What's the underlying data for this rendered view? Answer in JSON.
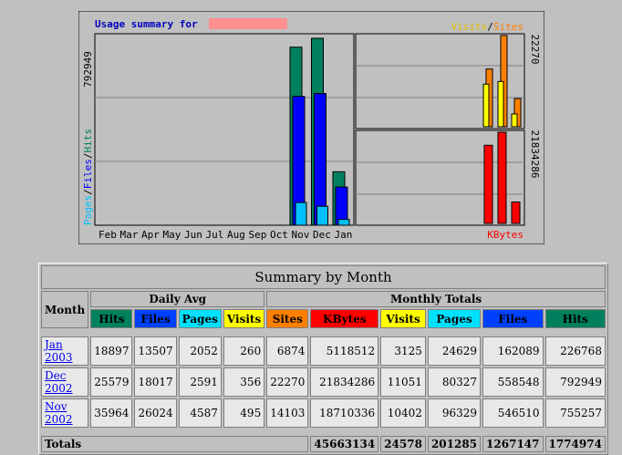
{
  "chart": {
    "title_prefix": "Usage summary for",
    "title_site": "",
    "legend_right_visits": "Visits",
    "legend_right_sep": "/",
    "legend_right_sites": "Sites",
    "kbytes_label": "KBytes",
    "left_axis_labels": {
      "pages": "Pages",
      "sep1": "/",
      "files": "Files",
      "sep2": "/",
      "hits": "Hits"
    },
    "left_max_label": "792949",
    "right_top_max_label": "22270",
    "right_bottom_max_label": "21834286",
    "months": [
      "Feb",
      "Mar",
      "Apr",
      "May",
      "Jun",
      "Jul",
      "Aug",
      "Sep",
      "Oct",
      "Nov",
      "Dec",
      "Jan"
    ],
    "colors": {
      "hits": "#00805c",
      "files": "#0000ff",
      "pages": "#00c0ff",
      "visits": "#ffff00",
      "sites": "#ff8000",
      "kbytes": "#ff0000",
      "bg": "#c0c0c0"
    }
  },
  "chart_data": {
    "type": "bar",
    "categories": [
      "Feb",
      "Mar",
      "Apr",
      "May",
      "Jun",
      "Jul",
      "Aug",
      "Sep",
      "Oct",
      "Nov",
      "Dec",
      "Jan"
    ],
    "series": [
      {
        "name": "Hits",
        "values": [
          0,
          0,
          0,
          0,
          0,
          0,
          0,
          0,
          0,
          755257,
          792949,
          226768
        ]
      },
      {
        "name": "Files",
        "values": [
          0,
          0,
          0,
          0,
          0,
          0,
          0,
          0,
          0,
          546510,
          558548,
          162089
        ]
      },
      {
        "name": "Pages",
        "values": [
          0,
          0,
          0,
          0,
          0,
          0,
          0,
          0,
          0,
          96329,
          80327,
          24629
        ]
      },
      {
        "name": "Visits",
        "values": [
          10402,
          11051,
          3125
        ]
      },
      {
        "name": "Sites",
        "values": [
          14103,
          22270,
          6874
        ]
      },
      {
        "name": "KBytes",
        "values": [
          18710336,
          21834286,
          5118512
        ]
      }
    ],
    "ylim_left": [
      0,
      792949
    ],
    "ylim_right_top": [
      0,
      22270
    ],
    "ylim_right_bottom": [
      0,
      21834286
    ]
  },
  "table": {
    "caption": "Summary by Month",
    "month_header": "Month",
    "daily_avg_header": "Daily Avg",
    "monthly_totals_header": "Monthly Totals",
    "cols_daily": [
      "Hits",
      "Files",
      "Pages",
      "Visits"
    ],
    "cols_monthly": [
      "Sites",
      "KBytes",
      "Visits",
      "Pages",
      "Files",
      "Hits"
    ],
    "rows": [
      {
        "month": "Jan 2003",
        "vals": [
          "18897",
          "13507",
          "2052",
          "260",
          "6874",
          "5118512",
          "3125",
          "24629",
          "162089",
          "226768"
        ]
      },
      {
        "month": "Dec 2002",
        "vals": [
          "25579",
          "18017",
          "2591",
          "356",
          "22270",
          "21834286",
          "11051",
          "80327",
          "558548",
          "792949"
        ]
      },
      {
        "month": "Nov 2002",
        "vals": [
          "35964",
          "26024",
          "4587",
          "495",
          "14103",
          "18710336",
          "10402",
          "96329",
          "546510",
          "755257"
        ]
      }
    ],
    "totals_label": "Totals",
    "totals": [
      "45663134",
      "24578",
      "201285",
      "1267147",
      "1774974"
    ]
  }
}
